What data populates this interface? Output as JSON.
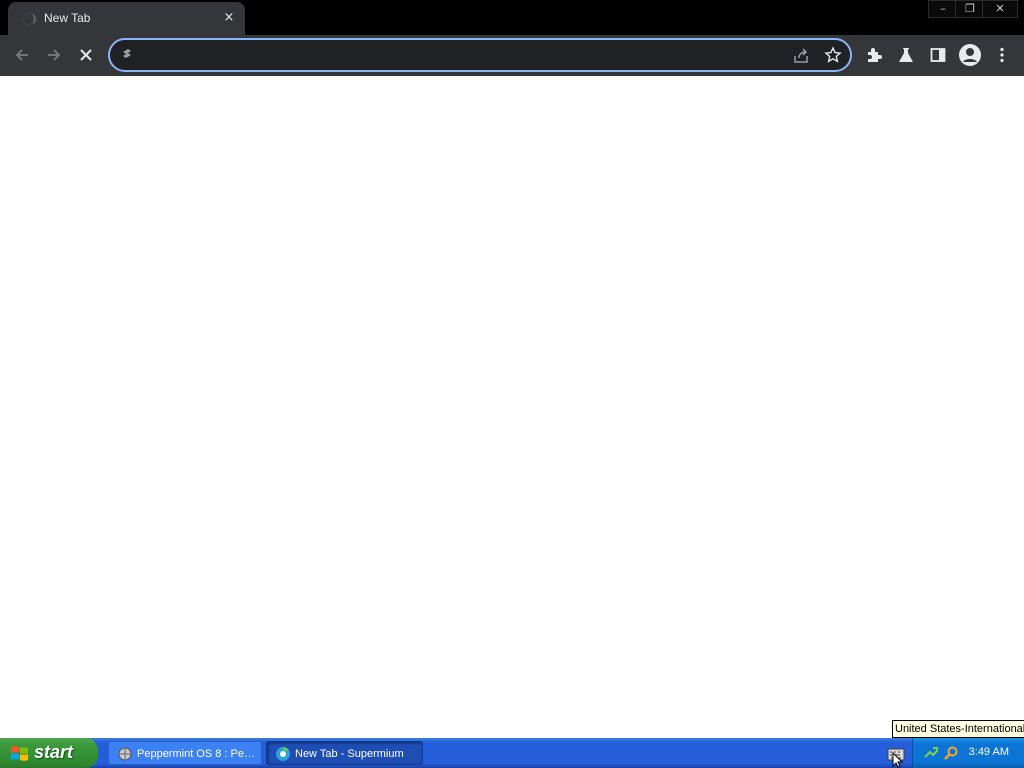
{
  "browser": {
    "tab": {
      "title": "New Tab",
      "close_glyph": "×"
    },
    "window_controls": {
      "minimize": "–",
      "restore": "❐",
      "close": "✕"
    },
    "omnibox": {
      "value": "",
      "placeholder": ""
    },
    "toolbar_icons": [
      "back-icon",
      "forward-icon",
      "stop-icon",
      "extensions-icon",
      "labs-icon",
      "side-panel-icon",
      "profile-icon",
      "menu-icon"
    ],
    "accent": "#8ab4f8"
  },
  "taskbar": {
    "start_label": "start",
    "tasks": [
      {
        "label": "Peppermint OS 8 : Pe…"
      },
      {
        "label": "New Tab - Supermium"
      }
    ],
    "clock": "3:49 AM",
    "tooltip": "United States-International"
  }
}
